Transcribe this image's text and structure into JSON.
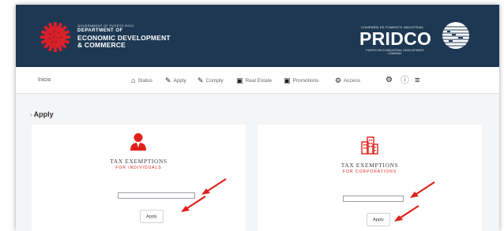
{
  "header": {
    "ddec": {
      "gov_line": "GOVERNMENT OF PUERTO RICO",
      "dept_line": "DEPARTMENT OF",
      "name_line1": "ECONOMIC DEVELOPMENT",
      "name_line2": "& COMMERCE"
    },
    "pridco": {
      "top_line": "COMPAÑÍA DE FOMENTO INDUSTRIAL",
      "name": "PRIDCO",
      "sub_line": "PUERTO RICO INDUSTRIAL DEVELOPMENT COMPANY"
    }
  },
  "nav": {
    "home": "Inicio",
    "items": [
      {
        "icon": "home-icon",
        "glyph": "⌂",
        "label": "Status"
      },
      {
        "icon": "edit-icon",
        "glyph": "✎",
        "label": "Apply"
      },
      {
        "icon": "comply-icon",
        "glyph": "✎",
        "label": "Comply"
      },
      {
        "icon": "building-icon",
        "glyph": "▣",
        "label": "Real Estate"
      },
      {
        "icon": "promotions-icon",
        "glyph": "▣",
        "label": "Promotions"
      },
      {
        "icon": "gear-icon",
        "glyph": "⚙",
        "label": "Access"
      }
    ],
    "utility_icons": [
      "settings-icon",
      "info-icon",
      "menu-icon"
    ]
  },
  "breadcrumb": {
    "current": "Apply"
  },
  "cards": [
    {
      "icon": "user-icon",
      "title": "TAX EXEMPTIONS",
      "subtitle": "FOR INDIVIDUALS",
      "input_value": "",
      "button_label": "Apply"
    },
    {
      "icon": "office-building-icon",
      "title": "TAX EXEMPTIONS",
      "subtitle": "FOR CORPORATIONS",
      "input_value": "",
      "button_label": "Apply"
    }
  ],
  "colors": {
    "header_bg": "#1e3853",
    "accent_red": "#e0211b",
    "page_bg": "#f4f5f7"
  }
}
